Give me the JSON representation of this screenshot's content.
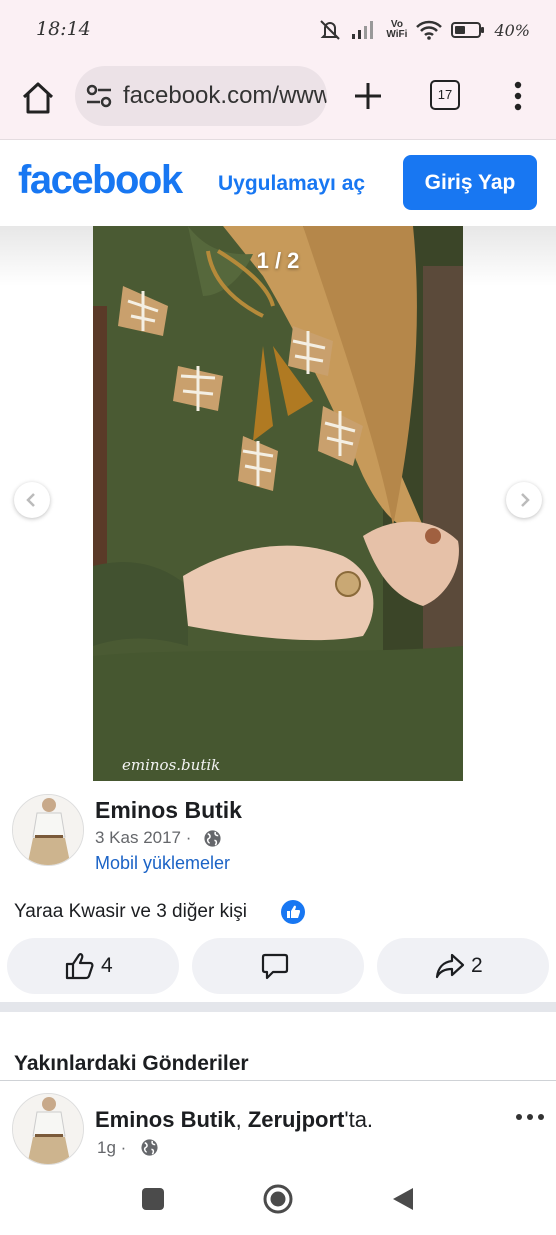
{
  "status_bar": {
    "time": "18:14",
    "vo_label": "Vo",
    "wifi_label": "WiFi",
    "battery_pct": "40%"
  },
  "browser": {
    "url": "facebook.com/wwww",
    "tab_count": "17"
  },
  "header": {
    "logo": "facebook",
    "open_app": "Uygulamayı aç",
    "login": "Giriş Yap"
  },
  "photo": {
    "counter": "1 / 2",
    "watermark": "eminos.butik",
    "colors": {
      "dress": "#4a5a33",
      "hijab": "#c79a5a",
      "embroidery": "#f4efe3"
    }
  },
  "post": {
    "author": "Eminos Butik",
    "date": "3 Kas 2017 ·",
    "album": "Mobil yüklemeler",
    "reactions_text": "Yaraa Kwasir ve 3 diğer kişi",
    "like_count": "4",
    "share_count": "2"
  },
  "nearby": {
    "title": "Yakınlardaki Gönderiler",
    "author": "Eminos Butik",
    "location_sep": ", ",
    "location": "Zerujport",
    "suffix": "'ta.",
    "time": "1g ·"
  },
  "icons": {
    "home": "home-icon",
    "tune": "site-settings-icon",
    "plus": "new-tab-icon",
    "menu": "more-vert-icon",
    "globe": "globe-icon",
    "like": "thumbs-up-icon",
    "comment": "comment-icon",
    "share": "share-icon"
  },
  "colors": {
    "fb_blue": "#1877f2",
    "link": "#1b63c6",
    "button_bg": "#f0f1f5"
  }
}
